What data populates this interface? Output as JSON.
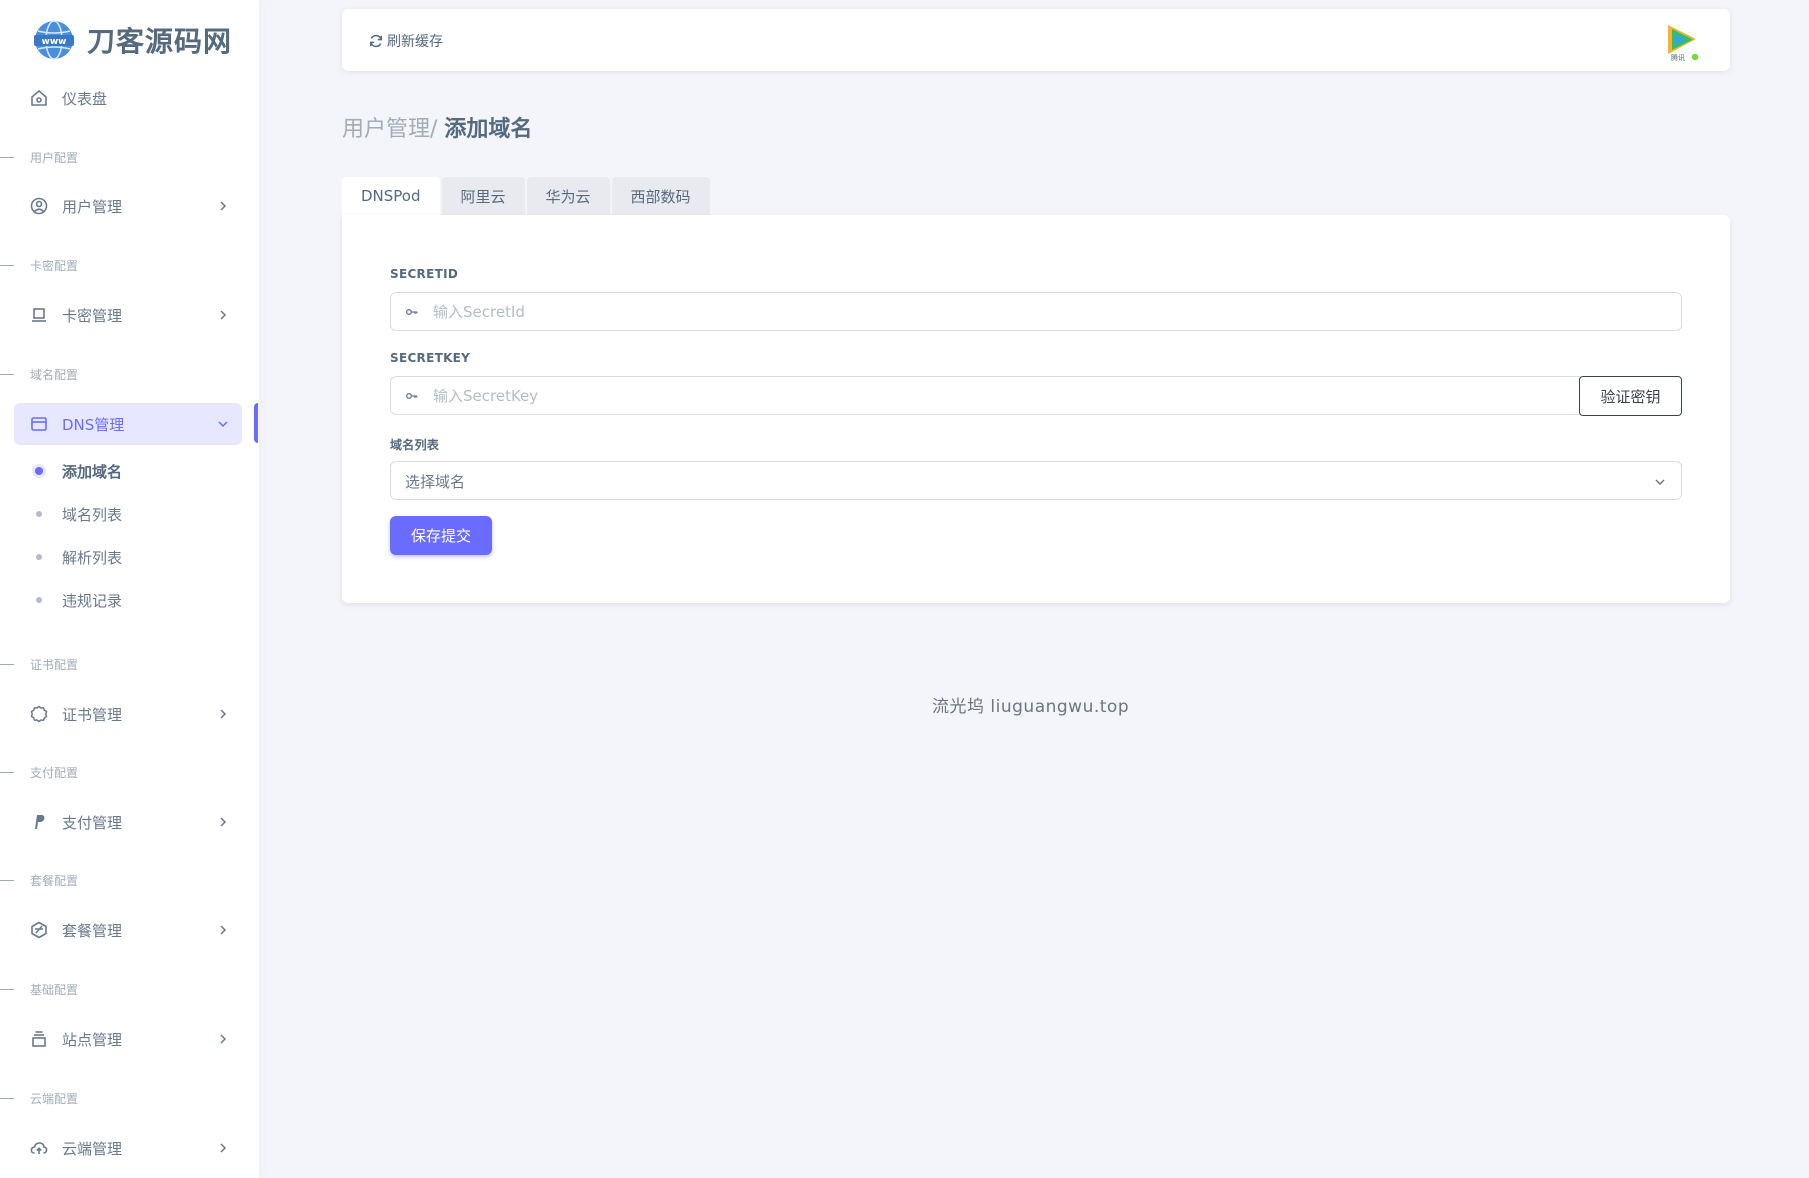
{
  "brand": {
    "name": "刀客源码网",
    "logo_icon": "www-globe-icon"
  },
  "sidebar": {
    "dashboard": {
      "label": "仪表盘",
      "icon": "home-icon"
    },
    "sections": [
      {
        "header": "用户配置",
        "item": "用户管理",
        "icon": "user-circle-icon"
      },
      {
        "header": "卡密配置",
        "item": "卡密管理",
        "icon": "laptop-icon"
      },
      {
        "header": "域名配置",
        "item": "DNS管理",
        "icon": "window-icon"
      },
      {
        "header": "证书配置",
        "item": "证书管理",
        "icon": "certificate-icon"
      },
      {
        "header": "支付配置",
        "item": "支付管理",
        "icon": "paypal-icon"
      },
      {
        "header": "套餐配置",
        "item": "套餐管理",
        "icon": "package-icon"
      },
      {
        "header": "基础配置",
        "item": "站点管理",
        "icon": "archive-icon"
      },
      {
        "header": "云端配置",
        "item": "云端管理",
        "icon": "cloud-upload-icon"
      }
    ],
    "dns_submenu": [
      "添加域名",
      "域名列表",
      "解析列表",
      "违规记录"
    ],
    "active_color": "#696cff"
  },
  "navbar": {
    "refresh_label": "刷新缓存",
    "avatar_icon": "video-play-icon"
  },
  "breadcrumb": {
    "parent": "用户管理/",
    "current": "添加域名"
  },
  "tabs": [
    "DNSPod",
    "阿里云",
    "华为云",
    "西部数码"
  ],
  "form": {
    "secret_id": {
      "label": "SECRETID",
      "placeholder": "输入SecretId"
    },
    "secret_key": {
      "label": "SECRETKEY",
      "placeholder": "输入SecretKey"
    },
    "verify_label": "验证密钥",
    "domain_list": {
      "label": "域名列表",
      "selected": "选择域名"
    },
    "save_label": "保存提交"
  },
  "watermark": "流光坞 liuguangwu.top"
}
